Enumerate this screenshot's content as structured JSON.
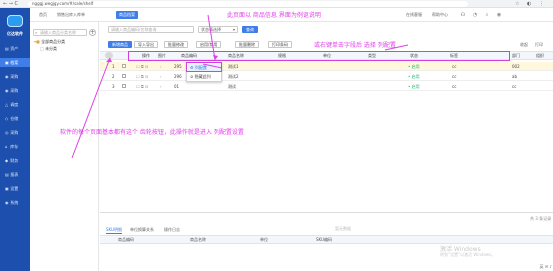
{
  "browser": {
    "nav": "← → C",
    "url": "ngggj.wegjgy.com/#/sale/shelf"
  },
  "app": {
    "logo_text": "亿达软件",
    "brand_color": "#1d4fae",
    "accent_color": "#3f7ee8"
  },
  "sidebar": {
    "items": [
      {
        "icon": "▤",
        "label": "资产"
      },
      {
        "icon": "▣",
        "label": "档案"
      },
      {
        "icon": "◉",
        "label": "采购"
      },
      {
        "icon": "◉",
        "label": "采购"
      },
      {
        "icon": "△",
        "label": "调度"
      },
      {
        "icon": "◇",
        "label": "仓储"
      },
      {
        "icon": "◎",
        "label": "采购"
      },
      {
        "icon": "⌂",
        "label": "库存"
      },
      {
        "icon": "◆",
        "label": "财务"
      },
      {
        "icon": "▤",
        "label": "报表"
      },
      {
        "icon": "▣",
        "label": "设置"
      },
      {
        "icon": "◉",
        "label": "系统"
      }
    ]
  },
  "topbar": {
    "tabs": [
      "首页",
      "销售出库入库单",
      "商品档案"
    ],
    "right_items": [
      "在线客服",
      "帮助中心"
    ]
  },
  "tree": {
    "search_placeholder": "请输入商品分类名称",
    "root": "全部商品分类",
    "child": "未分类"
  },
  "filters": {
    "keyword_placeholder": "请输入商品编码/名称查询",
    "status_select": "状态请选择",
    "query_btn": "查询"
  },
  "toolbar": {
    "buttons": [
      "新增商品",
      "导入导出",
      "批量修改",
      "启用/禁用",
      "批量删除",
      "打印条码"
    ],
    "right": [
      "收起",
      "打印"
    ]
  },
  "grid": {
    "headers": [
      "操作",
      "图片",
      "商品编码",
      "商品名称",
      "规格",
      "单位",
      "类型",
      "状态",
      "标签",
      "部门",
      "组织"
    ],
    "rows": [
      {
        "no": "1",
        "code": "295",
        "name": "测试1",
        "status": "• 启用",
        "dept": "cc",
        "org": "002"
      },
      {
        "no": "2",
        "code": "296",
        "name": "测试2",
        "status": "• 启用",
        "dept": "cc",
        "org": "ab"
      },
      {
        "no": "3",
        "code": "01",
        "name": "测试",
        "status": "• 启用",
        "dept": "cc",
        "org": "cc"
      }
    ]
  },
  "context_menu": {
    "items": [
      "列配置",
      "隐藏此列"
    ]
  },
  "annotations": {
    "top": "此页面以 商品信息 界面为例讴说明",
    "right": "或右键单击字段后 选择 列配置",
    "left": "软件的每个页面基本都有这个 齿轮按钮，此操作就是进入 列配置设置",
    "color": "#e040e8"
  },
  "bottom": {
    "tabs": [
      "SKU明细",
      "单位换算关系",
      "操作日志"
    ],
    "headers": [
      "商品编码",
      "商品名称",
      "单位",
      "SKU编码"
    ],
    "page_info": "共 3 条记录",
    "empty_hint": "暂无数据"
  },
  "watermark": {
    "line1": "激活 Windows",
    "line2": "转到“设置”以激活 Windows。"
  },
  "tray": "英 ✉ ♪"
}
